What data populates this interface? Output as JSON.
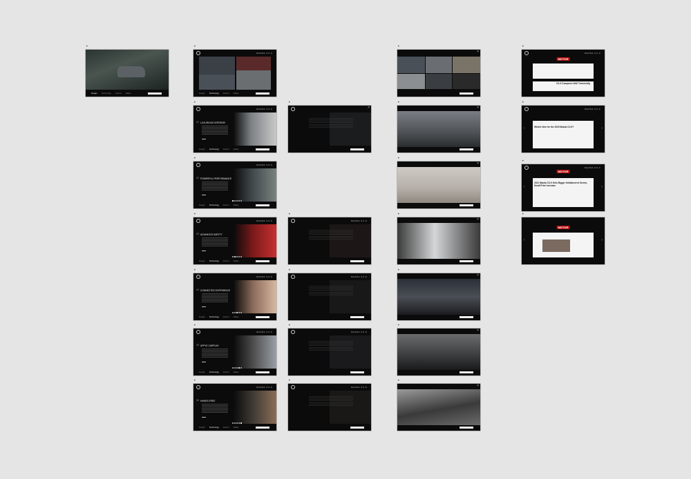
{
  "window_dots": "• • •",
  "nav": {
    "tabs": [
      "Design",
      "Technology",
      "Interior",
      "Safety",
      "Reviews"
    ],
    "top_menu": "MAZDA CX-9"
  },
  "colors": {
    "page_bg": "#e5e5e5",
    "frame_bg": "#0b0b0b",
    "accent": "#b11111"
  },
  "panels": {
    "r1": {
      "title": "LUXURIOUS INTERIOR",
      "num": "01"
    },
    "r2": {
      "title": "POWERFUL PERFORMANCE",
      "num": "02"
    },
    "r3": {
      "title": "ADVANCED SAFETY",
      "num": "03"
    },
    "r4": {
      "title": "CONNECTED EXPERIENCE",
      "num": "04"
    },
    "r5": {
      "title": "APPLE CARPLAY",
      "num": "05"
    },
    "r6": {
      "title": "HANDS-FREE",
      "num": "06"
    }
  },
  "reviews": {
    "brand": "MOTOR",
    "h1": "What's New for the 2020 Mazda CX-9?",
    "h2": "2021 Mazda CX-9 Gets Bigger Infotainment Screen, Small Price Increase",
    "h3": "CX-9 Compares Well Technically"
  },
  "icons": [
    "mazda-logo-icon",
    "close-icon",
    "arrow-left-icon",
    "arrow-right-icon"
  ]
}
